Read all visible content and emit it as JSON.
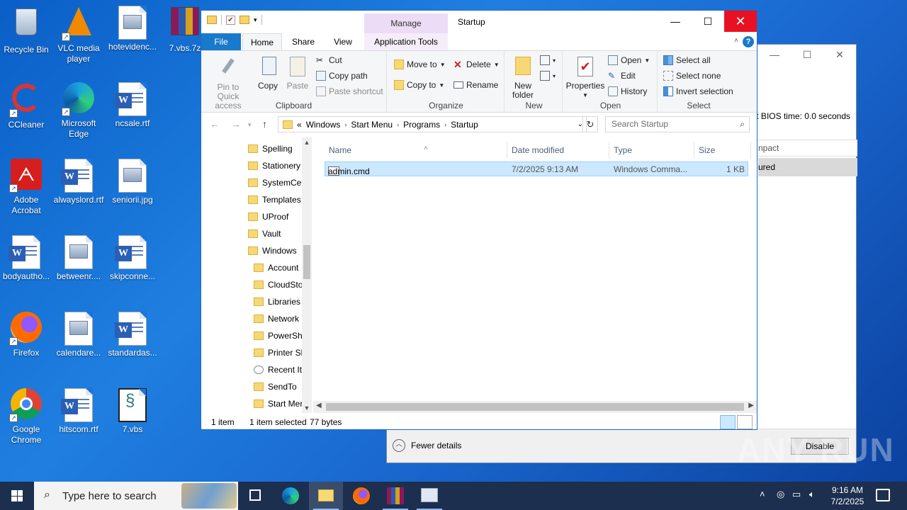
{
  "desktop": {
    "icons": [
      {
        "label": "Recycle Bin"
      },
      {
        "label": "VLC media player"
      },
      {
        "label": "hotevidenc..."
      },
      {
        "label": "7.vbs.7z"
      },
      {
        "label": "CCleaner"
      },
      {
        "label": "Microsoft Edge"
      },
      {
        "label": "ncsale.rtf"
      },
      {
        "label": "Adobe Acrobat"
      },
      {
        "label": "alwayslord.rtf"
      },
      {
        "label": "seniorii.jpg"
      },
      {
        "label": "bodyautho..."
      },
      {
        "label": "betweenr...."
      },
      {
        "label": "skipconne..."
      },
      {
        "label": "Firefox"
      },
      {
        "label": "calendare..."
      },
      {
        "label": "standardas..."
      },
      {
        "label": "Google Chrome"
      },
      {
        "label": "hitscom.rtf"
      },
      {
        "label": "7.vbs"
      }
    ]
  },
  "bg_window": {
    "bios_text": "t BIOS time:  0.0 seconds",
    "impact_header": "npact",
    "impact_value": "ured",
    "fewer_details": "Fewer details",
    "disable": "Disable"
  },
  "explorer": {
    "title": "Startup",
    "manage_tab": "Manage",
    "tabs": {
      "file": "File",
      "home": "Home",
      "share": "Share",
      "view": "View",
      "app_tools": "Application Tools"
    },
    "ribbon": {
      "clipboard": {
        "label": "Clipboard",
        "pin": "Pin to Quick access",
        "copy": "Copy",
        "paste": "Paste",
        "cut": "Cut",
        "copy_path": "Copy path",
        "paste_shortcut": "Paste shortcut"
      },
      "organize": {
        "label": "Organize",
        "move_to": "Move to",
        "copy_to": "Copy to",
        "delete": "Delete",
        "rename": "Rename"
      },
      "new": {
        "label": "New",
        "new_folder": "New folder"
      },
      "open": {
        "label": "Open",
        "properties": "Properties",
        "open": "Open",
        "edit": "Edit",
        "history": "History"
      },
      "select": {
        "label": "Select",
        "select_all": "Select all",
        "select_none": "Select none",
        "invert": "Invert selection"
      }
    },
    "address": {
      "prefix": "«",
      "crumbs": [
        "Windows",
        "Start Menu",
        "Programs",
        "Startup"
      ],
      "search_placeholder": "Search Startup"
    },
    "nav_items": [
      "Spelling",
      "Stationery",
      "SystemCer",
      "Templates",
      "UProof",
      "Vault",
      "Windows",
      "Account",
      "CloudSto",
      "Libraries",
      "Network",
      "PowerSh",
      "Printer Sl",
      "Recent It",
      "SendTo",
      "Start Mer"
    ],
    "columns": {
      "name": "Name",
      "date": "Date modified",
      "type": "Type",
      "size": "Size"
    },
    "files": [
      {
        "name": "admin.cmd",
        "date": "7/2/2025 9:13 AM",
        "type": "Windows Comma...",
        "size": "1 KB"
      }
    ],
    "status": {
      "count": "1 item",
      "selected": "1 item selected",
      "bytes": "77 bytes"
    }
  },
  "taskbar": {
    "search_text": "Type here to search",
    "time": "9:16 AM",
    "date": "7/2/2025"
  },
  "watermark": "ANY RUN"
}
